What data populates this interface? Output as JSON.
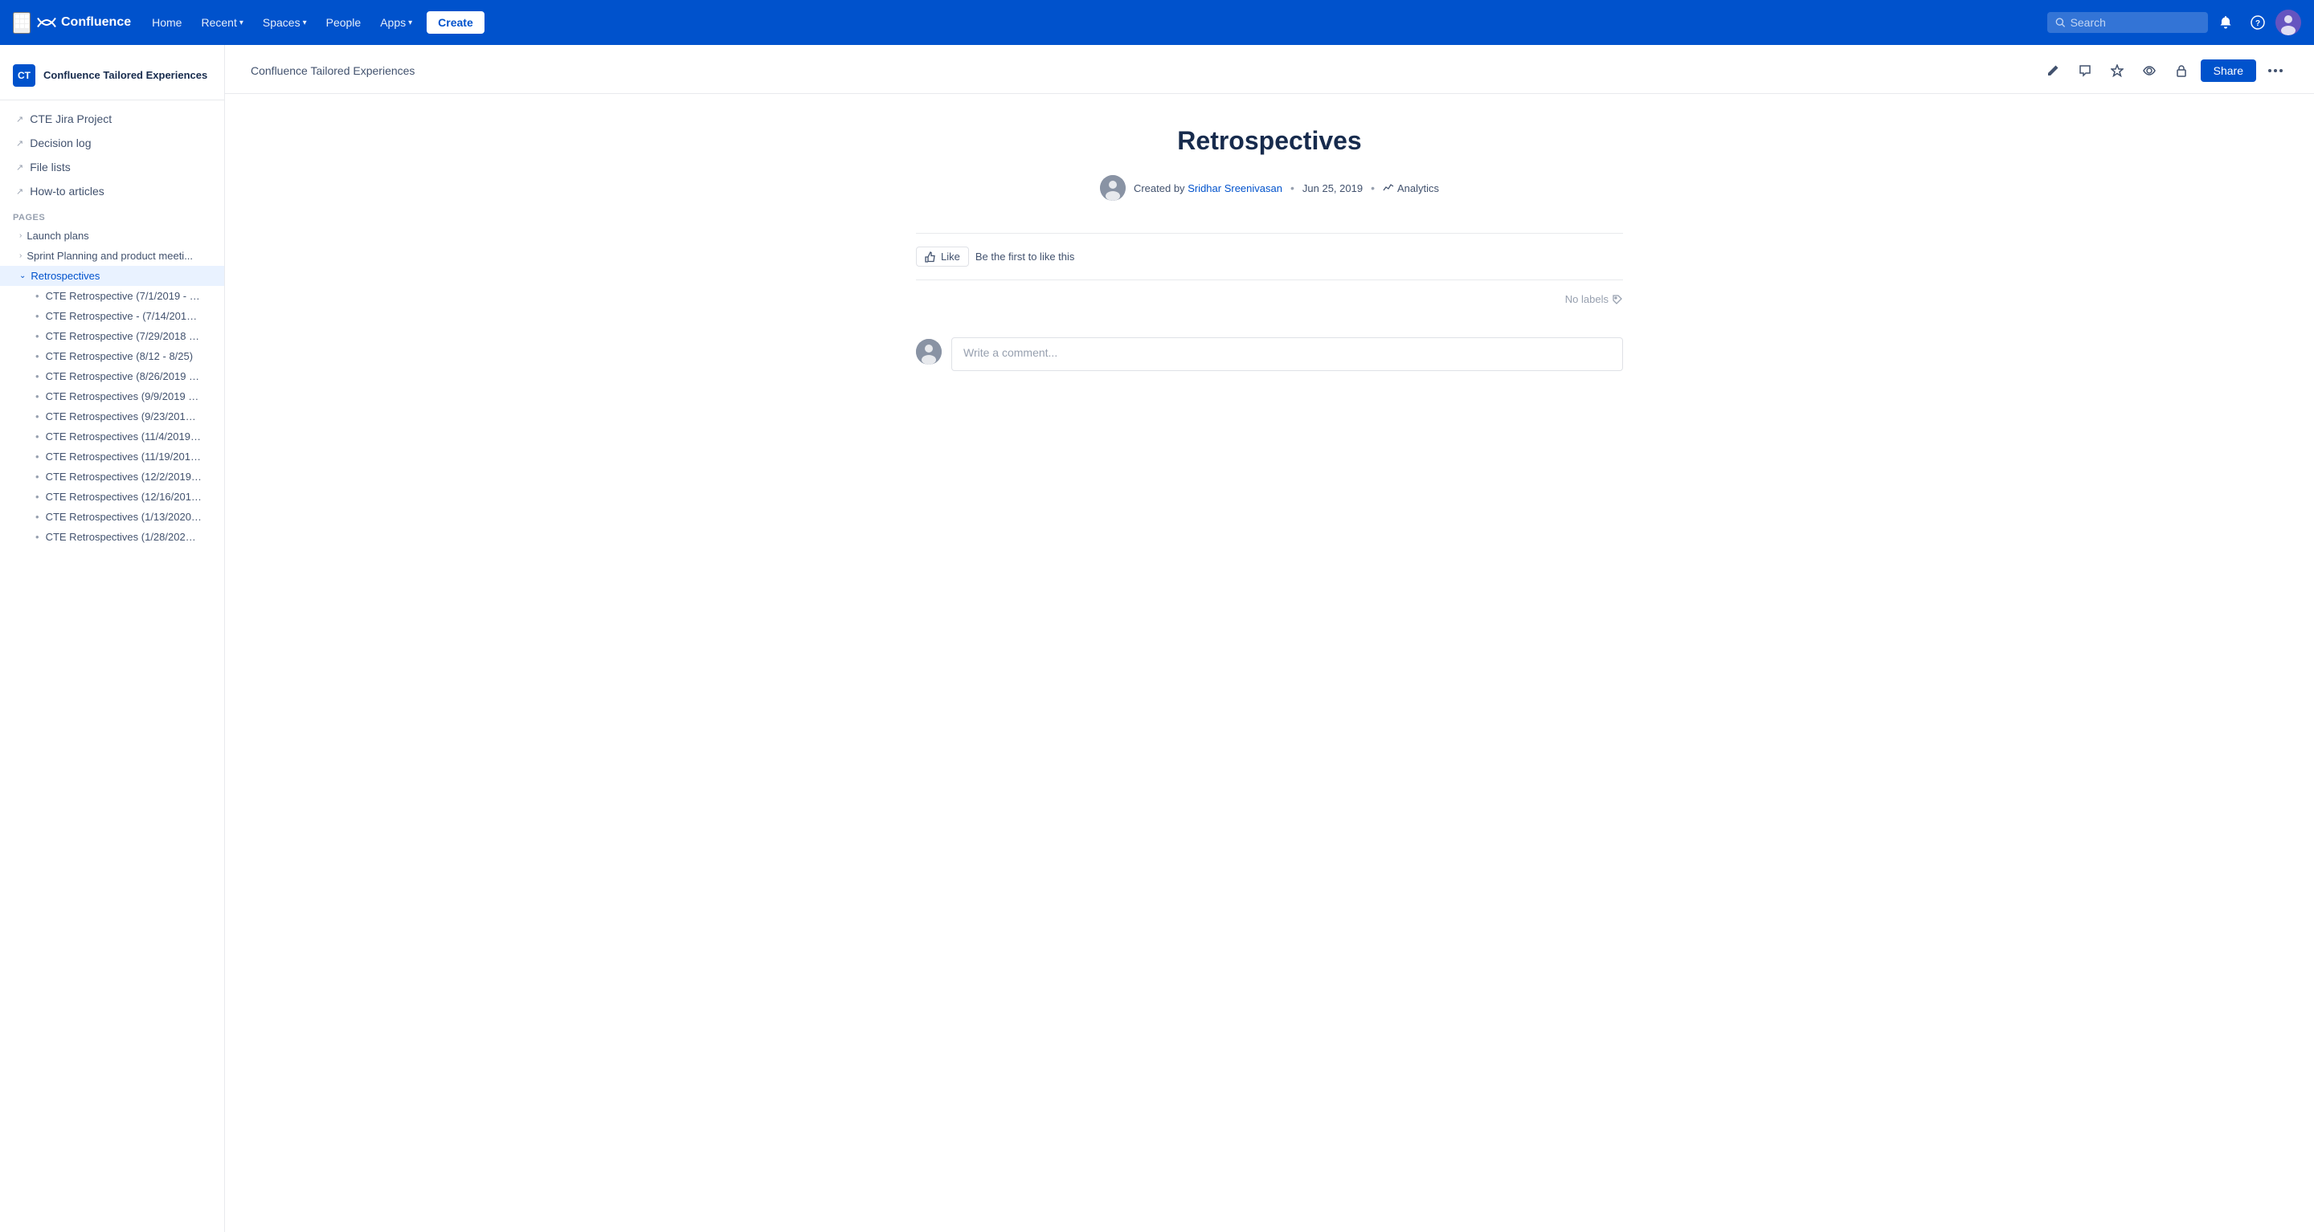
{
  "topnav": {
    "logo_text": "Confluence",
    "home_label": "Home",
    "recent_label": "Recent",
    "spaces_label": "Spaces",
    "people_label": "People",
    "apps_label": "Apps",
    "create_label": "Create",
    "search_placeholder": "Search"
  },
  "sidebar": {
    "space_name": "Confluence Tailored Experiences",
    "space_initials": "CT",
    "nav_items": [
      {
        "label": "CTE Jira Project"
      },
      {
        "label": "Decision log"
      },
      {
        "label": "File lists"
      },
      {
        "label": "How-to articles"
      }
    ],
    "pages_section_label": "PAGES",
    "pages": [
      {
        "label": "Launch plans",
        "expanded": false
      },
      {
        "label": "Sprint Planning and product meeti...",
        "expanded": false
      },
      {
        "label": "Retrospectives",
        "expanded": true,
        "active": true
      }
    ],
    "children": [
      {
        "label": "CTE Retrospective (7/1/2019 - …"
      },
      {
        "label": "CTE Retrospective - (7/14/201…"
      },
      {
        "label": "CTE Retrospective (7/29/2018 …"
      },
      {
        "label": "CTE Retrospective (8/12 - 8/25)"
      },
      {
        "label": "CTE Retrospective (8/26/2019 …"
      },
      {
        "label": "CTE Retrospectives (9/9/2019 …"
      },
      {
        "label": "CTE Retrospectives (9/23/201…"
      },
      {
        "label": "CTE Retrospectives (11/4/2019…"
      },
      {
        "label": "CTE Retrospectives (11/19/201…"
      },
      {
        "label": "CTE Retrospectives (12/2/2019…"
      },
      {
        "label": "CTE Retrospectives (12/16/201…"
      },
      {
        "label": "CTE Retrospectives (1/13/2020…"
      },
      {
        "label": "CTE Retrospectives (1/28/202…"
      }
    ]
  },
  "content": {
    "breadcrumb": "Confluence Tailored Experiences",
    "title": "Retrospectives",
    "created_by_label": "Created by",
    "author_name": "Sridhar Sreenivasan",
    "date": "Jun 25, 2019",
    "analytics_label": "Analytics",
    "like_label": "Like",
    "like_prompt": "Be the first to like this",
    "no_labels": "No labels",
    "comment_placeholder": "Write a comment...",
    "share_label": "Share"
  },
  "icons": {
    "edit": "✏️",
    "comment": "💬",
    "star": "☆",
    "watch": "👁",
    "restrict": "🔒",
    "more": "···",
    "chevron_right": "›",
    "chevron_down": "⌄",
    "thumbs_up": "👍",
    "tag": "🏷",
    "analytics_chart": "📈"
  }
}
